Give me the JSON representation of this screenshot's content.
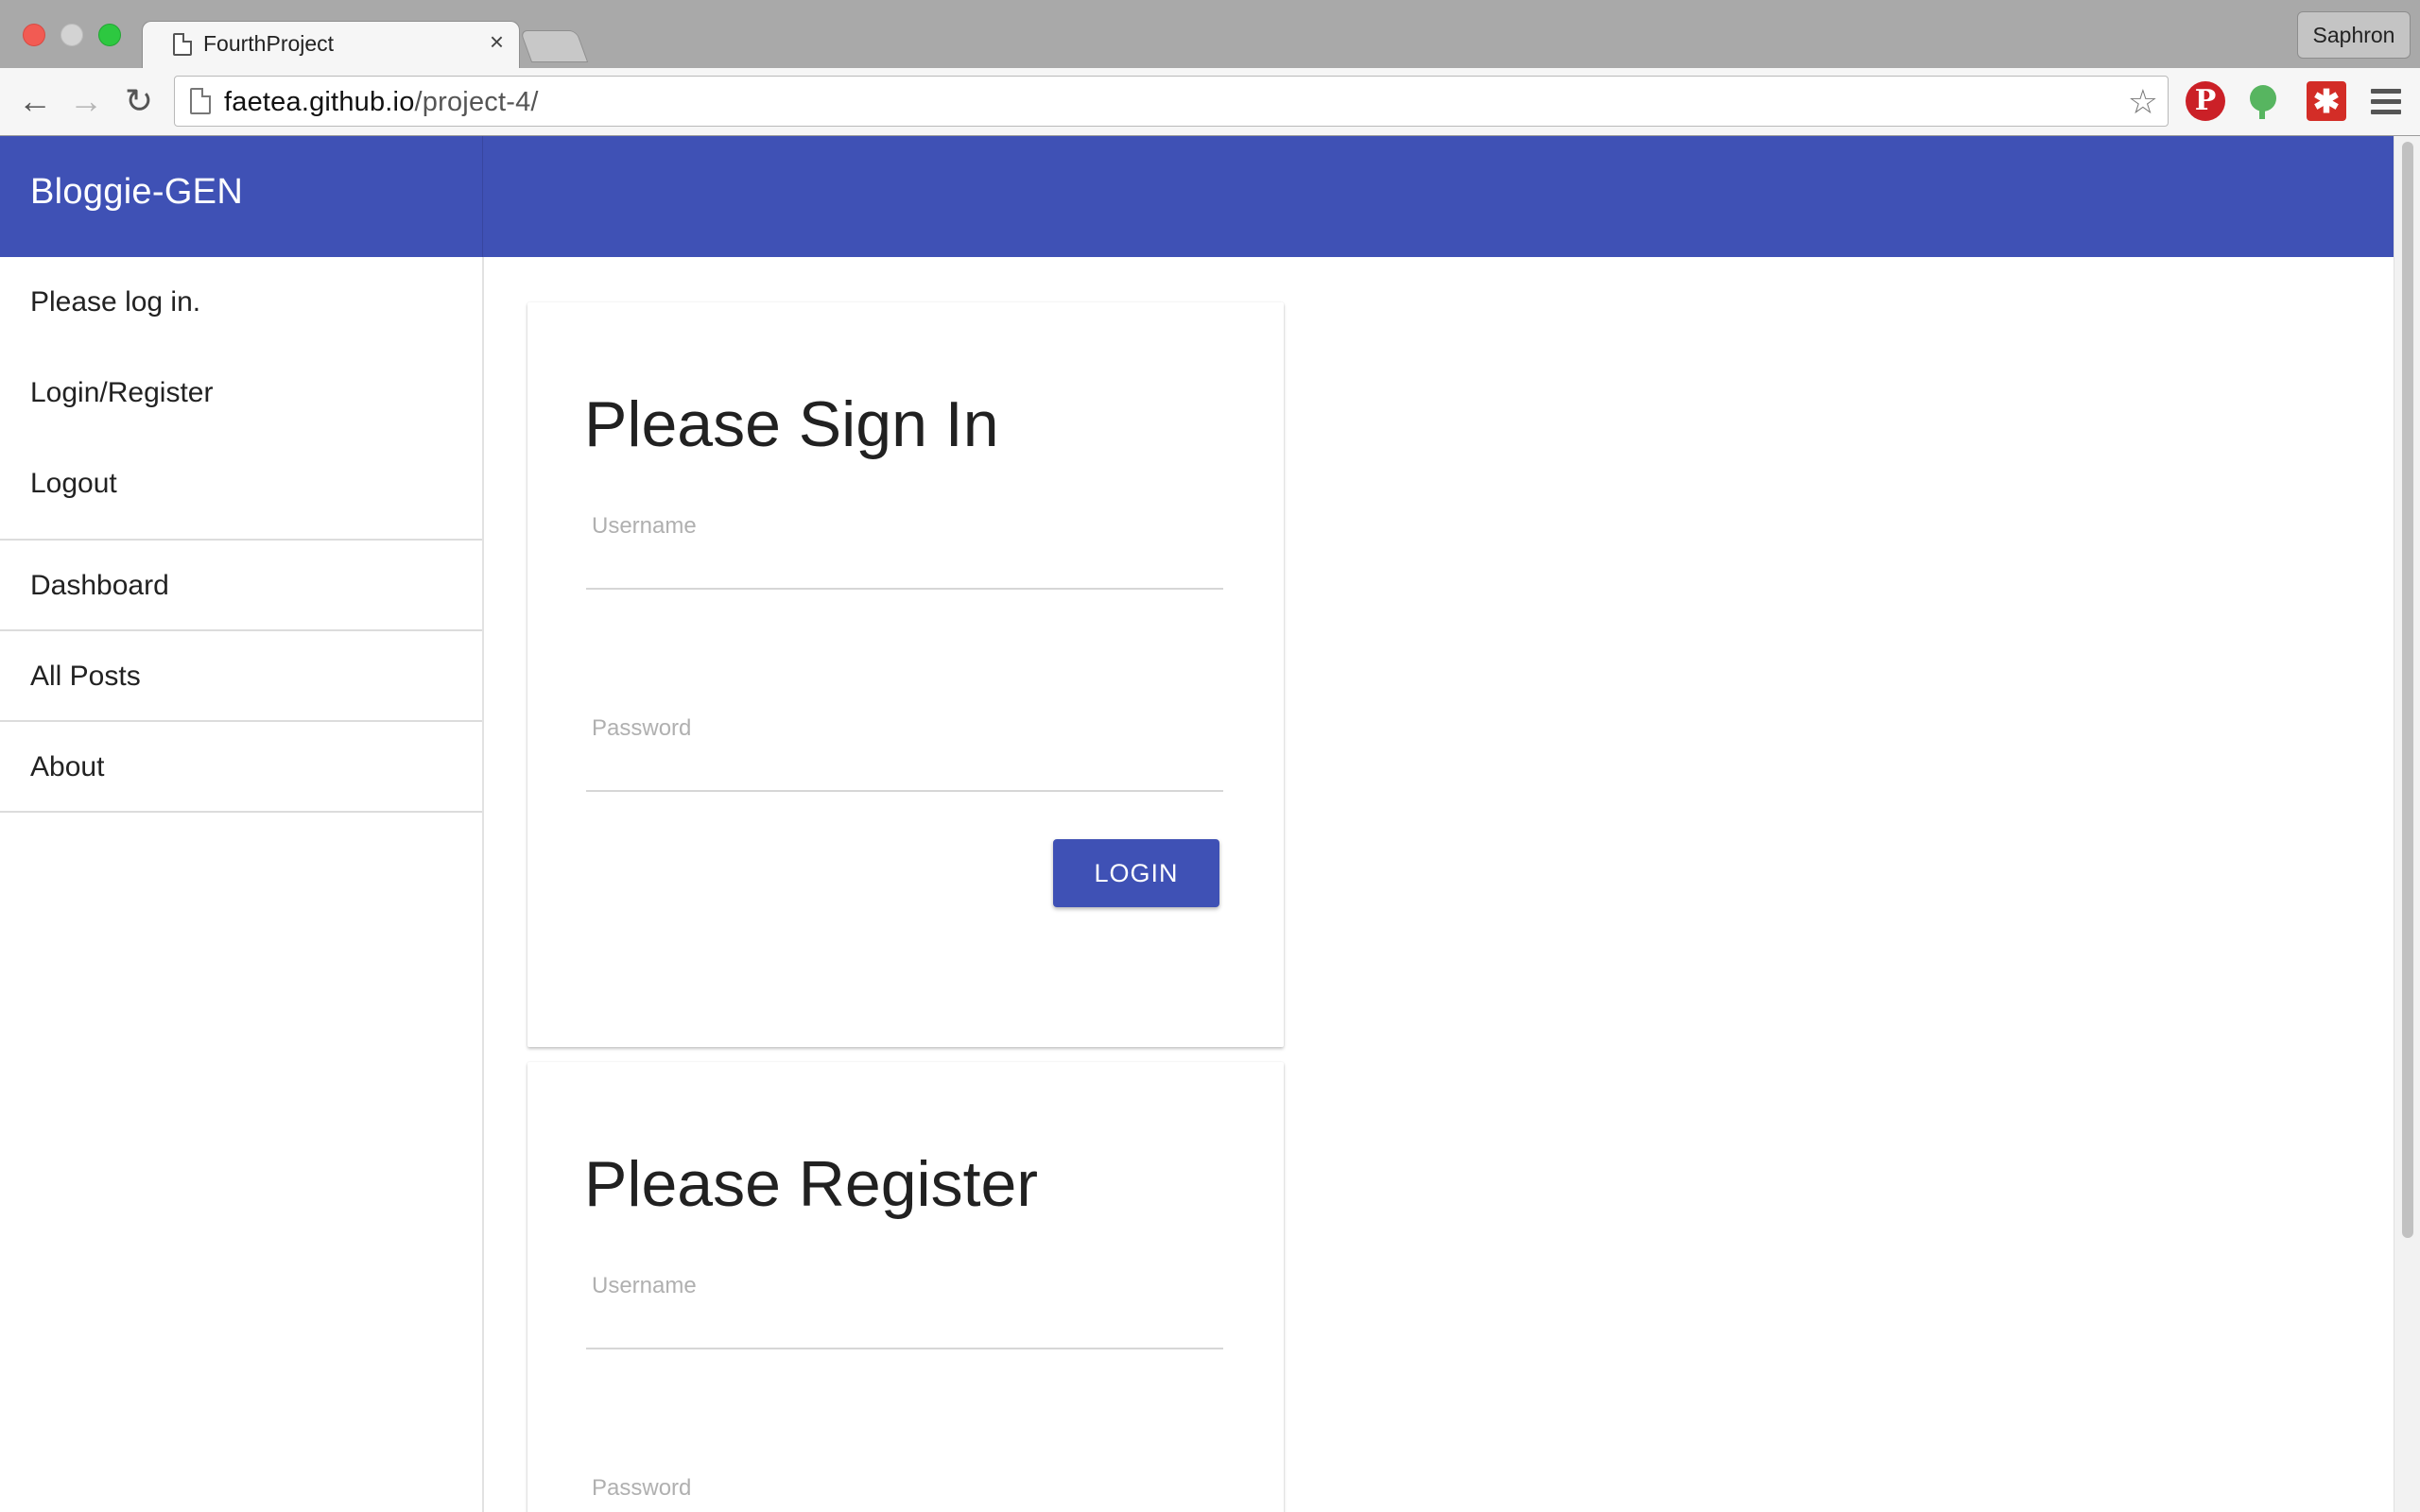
{
  "browser": {
    "tab_title": "FourthProject",
    "tab_close": "×",
    "profile_name": "Saphron",
    "url_host": "faetea.github.io",
    "url_path": "/project-4/",
    "extensions": [
      "pinterest-icon",
      "evernote-icon",
      "lastpass-icon"
    ]
  },
  "app": {
    "brand": "Bloggie-GEN",
    "accent_color": "#3f51b5"
  },
  "sidebar": {
    "status": "Please log in.",
    "items": [
      "Login/Register",
      "Logout",
      "Dashboard",
      "All Posts",
      "About"
    ]
  },
  "signin": {
    "title": "Please Sign In",
    "username_placeholder": "Username",
    "password_placeholder": "Password",
    "button": "LOGIN"
  },
  "register": {
    "title": "Please Register",
    "username_placeholder": "Username",
    "password_placeholder": "Password"
  }
}
